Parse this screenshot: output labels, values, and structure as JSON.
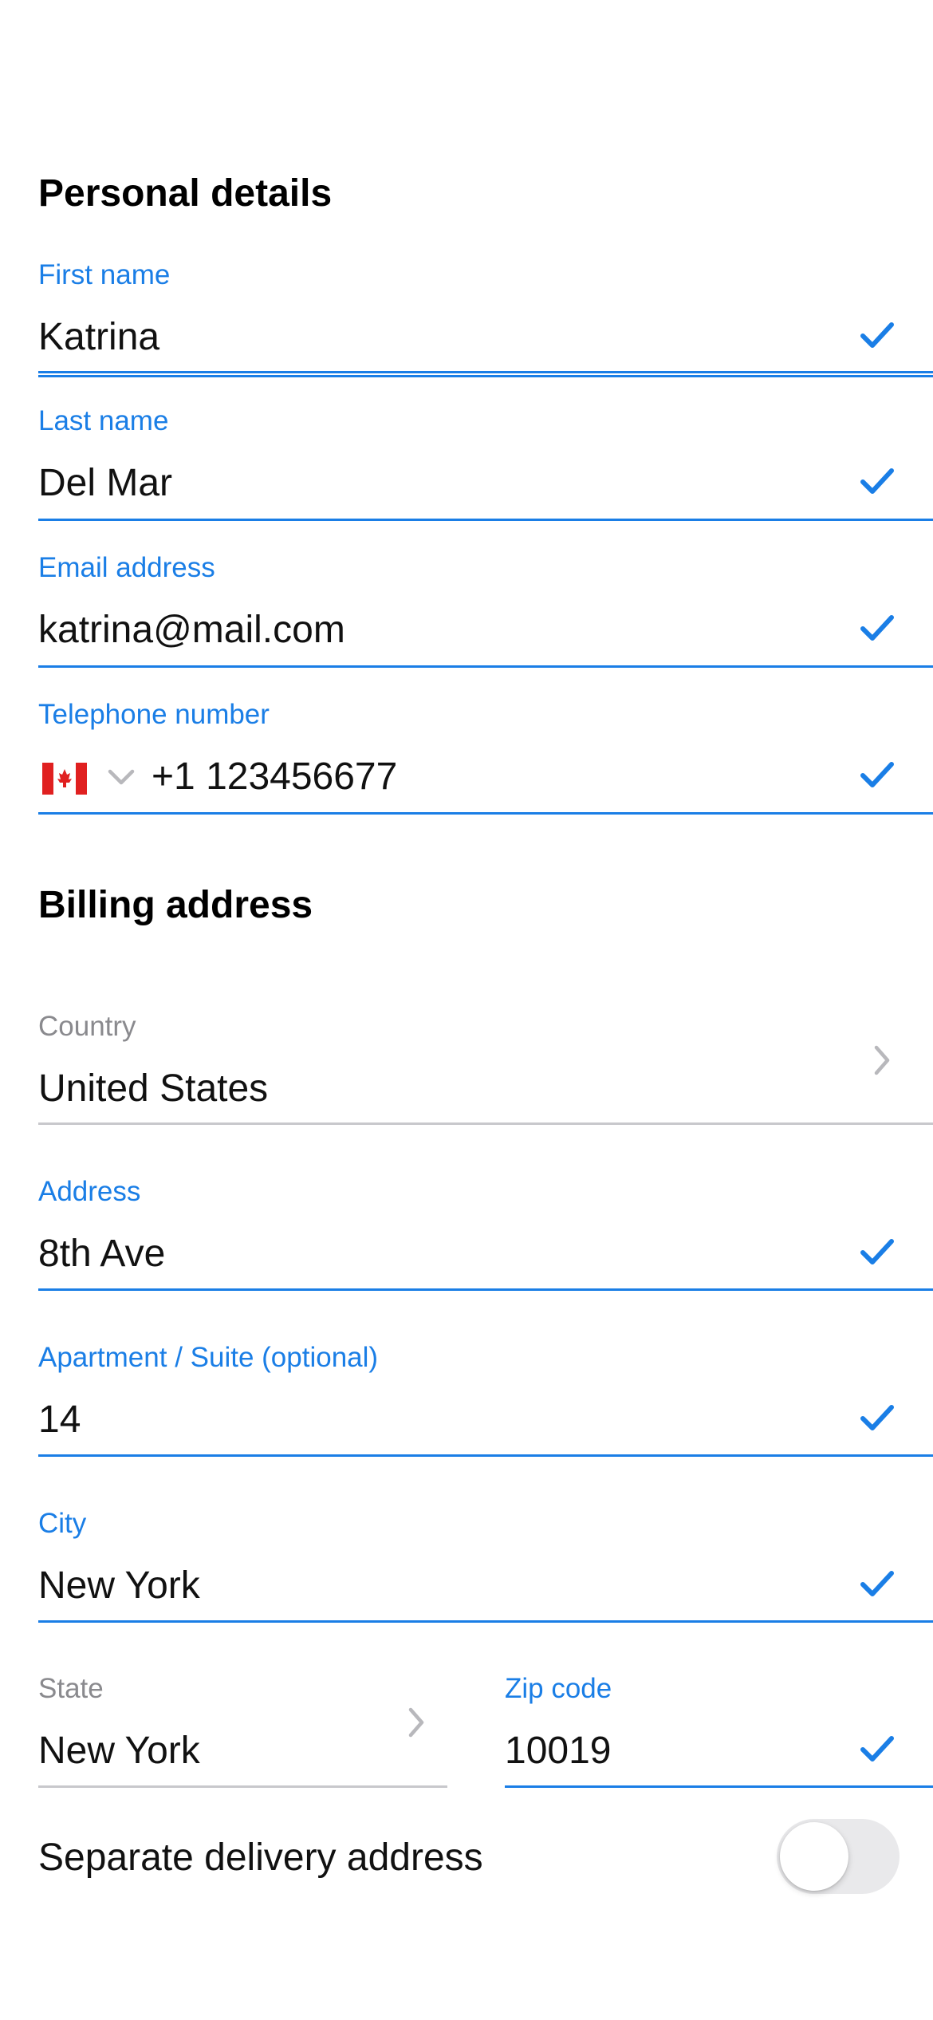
{
  "personal": {
    "title": "Personal details",
    "first_name": {
      "label": "First name",
      "value": "Katrina"
    },
    "last_name": {
      "label": "Last name",
      "value": "Del Mar"
    },
    "email": {
      "label": "Email address",
      "value": "katrina@mail.com"
    },
    "phone": {
      "label": "Telephone number",
      "value": "+1 123456677",
      "country_flag": "canada-flag-icon"
    }
  },
  "billing": {
    "title": "Billing address",
    "country": {
      "label": "Country",
      "value": "United States"
    },
    "address": {
      "label": "Address",
      "value": "8th Ave"
    },
    "apartment": {
      "label": "Apartment / Suite (optional)",
      "value": "14"
    },
    "city": {
      "label": "City",
      "value": "New York"
    },
    "state": {
      "label": "State",
      "value": "New York"
    },
    "zip": {
      "label": "Zip code",
      "value": "10019"
    }
  },
  "delivery": {
    "label": "Separate delivery address",
    "enabled": false
  },
  "colors": {
    "accent": "#1a7ee6",
    "label_gray": "#8a8a8e",
    "divider_gray": "#c8c8cc",
    "toggle_off": "#e9e9eb"
  }
}
